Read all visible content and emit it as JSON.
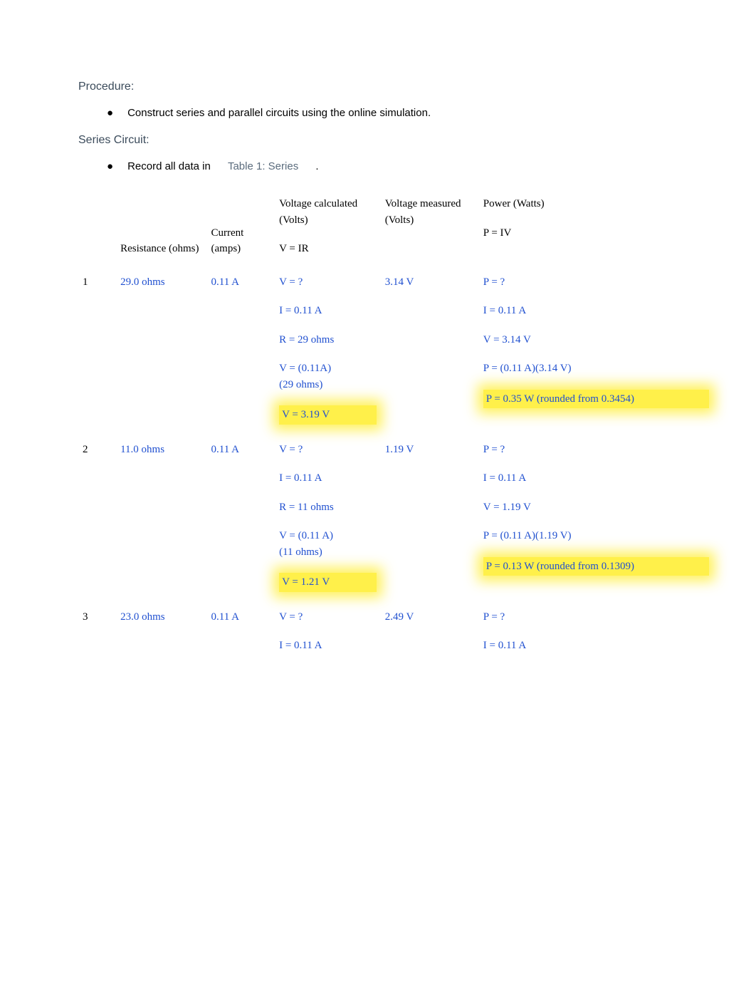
{
  "procedure_heading": "Procedure:",
  "bullet1": "Construct series and parallel circuits using the online simulation.",
  "series_heading": "Series Circuit:",
  "bullet2_prefix": "Record all data in",
  "table_label": "Table 1: Series",
  "bullet2_suffix": ".",
  "headers": {
    "num": "",
    "resistance": "Resistance (ohms)",
    "current": "Current (amps)",
    "v_calc_top": "Voltage calculated (Volts)",
    "v_calc_sub": "V = IR",
    "v_meas": "Voltage measured (Volts)",
    "power_top": "Power (Watts)",
    "power_sub": "P = IV"
  },
  "rows": [
    {
      "num": "1",
      "resistance": "29.0 ohms",
      "current": "0.11 A",
      "vcalc": {
        "l1": "V = ?",
        "l2": "I = 0.11 A",
        "l3": "R = 29 ohms",
        "l4a": "V = (0.11A)",
        "l4b": "(29 ohms)",
        "l5": "V = 3.19 V"
      },
      "vmeas": "3.14 V",
      "power": {
        "l1": "P = ?",
        "l2": "I = 0.11 A",
        "l3": "V = 3.14 V",
        "l4": "P = (0.11 A)(3.14 V)",
        "l5": "P = 0.35 W (rounded from 0.3454)"
      }
    },
    {
      "num": "2",
      "resistance": "11.0 ohms",
      "current": "0.11 A",
      "vcalc": {
        "l1": "V = ?",
        "l2": "I = 0.11 A",
        "l3": "R = 11 ohms",
        "l4a": "V = (0.11 A)",
        "l4b": "(11 ohms)",
        "l5": "V = 1.21 V"
      },
      "vmeas": "1.19 V",
      "power": {
        "l1": "P = ?",
        "l2": "I = 0.11 A",
        "l3": "V = 1.19 V",
        "l4": "P = (0.11 A)(1.19 V)",
        "l5": "P = 0.13 W (rounded from 0.1309)"
      }
    },
    {
      "num": "3",
      "resistance": "23.0 ohms",
      "current": "0.11 A",
      "vcalc": {
        "l1": "V = ?",
        "l2": "I = 0.11 A"
      },
      "vmeas": "2.49 V",
      "power": {
        "l1": "P = ?",
        "l2": "I = 0.11 A"
      }
    }
  ]
}
